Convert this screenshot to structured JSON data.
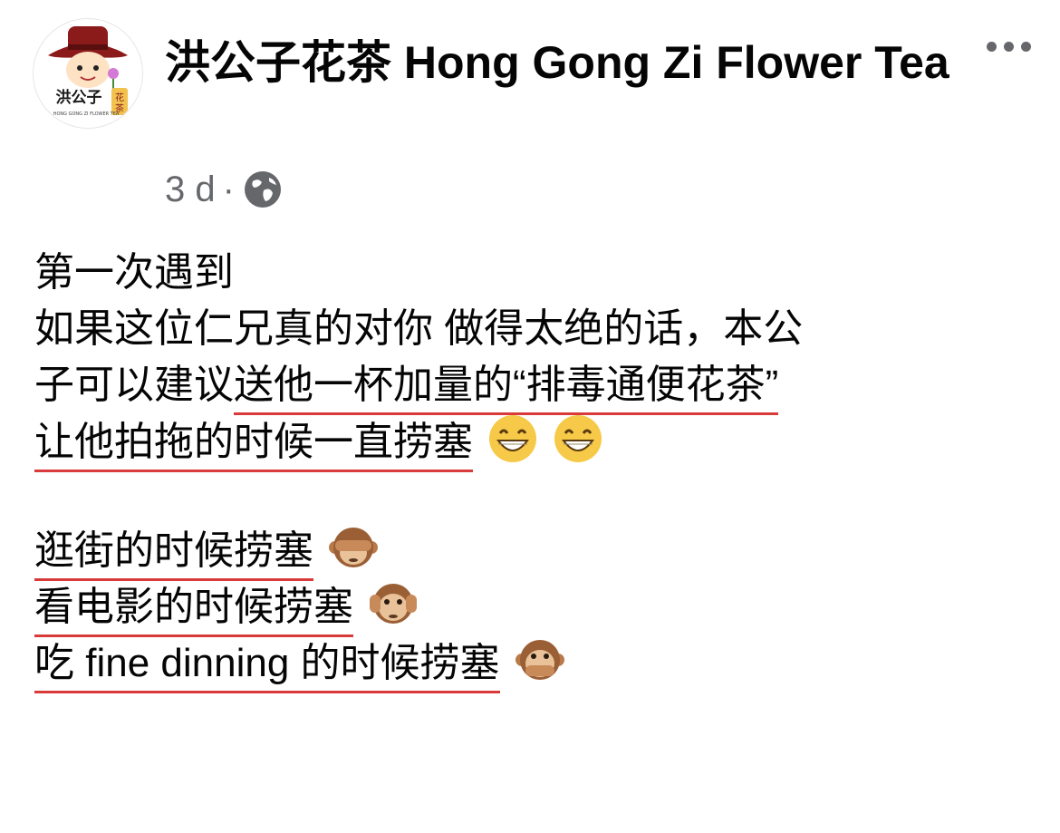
{
  "post": {
    "page_name": "洪公子花茶 Hong Gong Zi Flower Tea",
    "time": "3 d",
    "separator": "·",
    "audience_icon": "globe-icon",
    "more_icon": "more-options-icon",
    "avatar": {
      "logo_text": "洪公子",
      "logo_side_text": "花茶",
      "logo_sub_text": "HONG GONG ZI FLOWER TEA"
    }
  },
  "content": {
    "line1": "第一次遇到",
    "line2": "如果这位仁兄真的对你 做得太绝的话，本公",
    "line3_plain": "子可以建议",
    "line3_underlined": "送他一杯加量的“排毒通便花茶”",
    "line4_underlined": "让他拍拖的时候一直捞塞",
    "line4_emojis": [
      "grinning-face-emoji",
      "grinning-face-emoji"
    ],
    "line5_underlined": "逛街的时候捞塞",
    "line5_emoji": "see-no-evil-monkey-emoji",
    "line6_underlined": "看电影的时候捞塞",
    "line6_emoji": "hear-no-evil-monkey-emoji",
    "line7_underlined": "吃 fine dinning 的时候捞塞",
    "line7_emoji": "speak-no-evil-monkey-emoji"
  },
  "colors": {
    "underline": "#d93a3a",
    "text": "#050505",
    "meta": "#65676b"
  }
}
